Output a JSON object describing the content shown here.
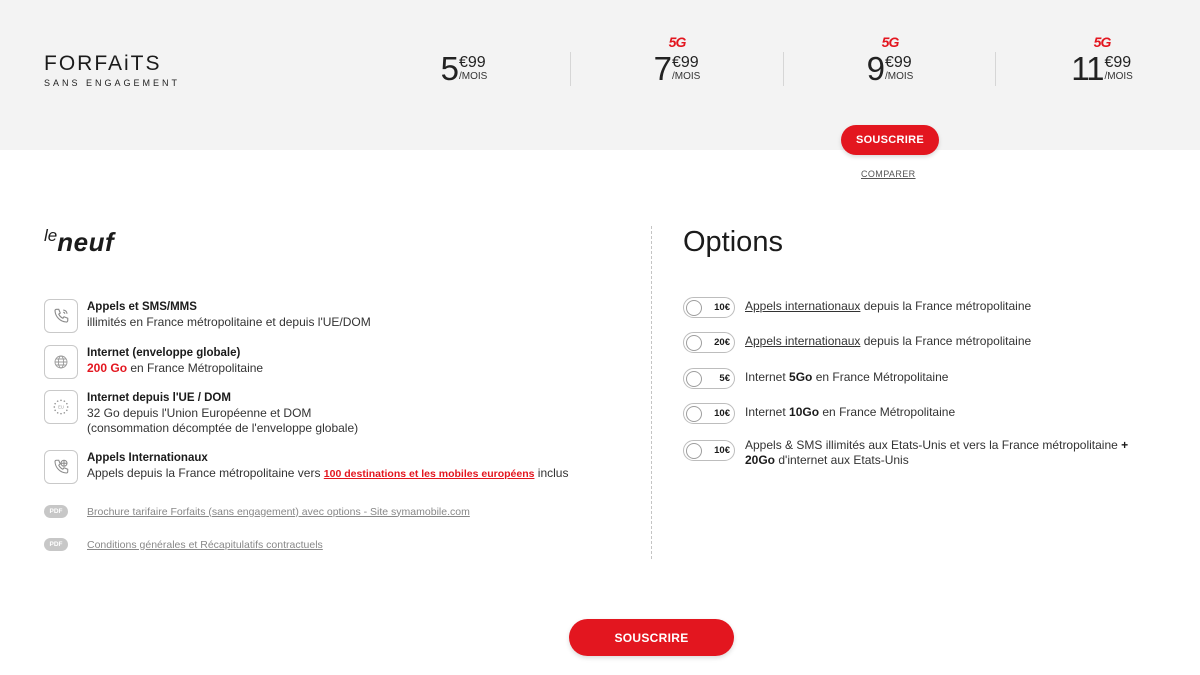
{
  "brand": {
    "title": "FORFAiTS",
    "subtitle": "SANS ENGAGEMENT"
  },
  "plans": [
    {
      "int": "5",
      "cents": "€99",
      "unit": "/MOIS",
      "badge": ""
    },
    {
      "int": "7",
      "cents": "€99",
      "unit": "/MOIS",
      "badge": "5G"
    },
    {
      "int": "9",
      "cents": "€99",
      "unit": "/MOIS",
      "badge": "5G"
    },
    {
      "int": "11",
      "cents": "€99",
      "unit": "/MOIS",
      "badge": "5G"
    }
  ],
  "subscribe_label": "SOUSCRIRE",
  "compare_label": "COMPARER",
  "left": {
    "title_le": "le",
    "title_neuf": "neuf",
    "features": [
      {
        "icon": "phone-icon",
        "title": "Appels et SMS/MMS",
        "line1": "illimités en France métropolitaine et depuis l'UE/DOM"
      },
      {
        "icon": "globe-icon",
        "title": "Internet (enveloppe globale)",
        "highlight": "200 Go",
        "line1": " en France Métropolitaine"
      },
      {
        "icon": "eu-stars-icon",
        "title": "Internet depuis l'UE / DOM",
        "line1": "32 Go depuis l'Union Européenne et DOM",
        "line2": "(consommation décomptée de l'enveloppe globale)"
      },
      {
        "icon": "international-call-icon",
        "title": "Appels Internationaux",
        "line1": "Appels depuis la France métropolitaine vers ",
        "link": "100 destinations et les mobiles européens",
        "line1_end": " inclus"
      }
    ],
    "pdf_badge": "PDF",
    "docs": [
      "Brochure tarifaire Forfaits (sans engagement) avec options - Site symamobile.com",
      "Conditions générales et Récapitulatifs contractuels"
    ]
  },
  "options": {
    "title": "Options",
    "items": [
      {
        "price": "10€",
        "link": "Appels internationaux",
        "text": " depuis la France métropolitaine"
      },
      {
        "price": "20€",
        "link": "Appels internationaux",
        "text": " depuis la France métropolitaine"
      },
      {
        "price": "5€",
        "pre": "Internet ",
        "bold": "5Go",
        "text": " en France Métropolitaine"
      },
      {
        "price": "10€",
        "pre": "Internet ",
        "bold": "10Go",
        "text": " en France Métropolitaine"
      },
      {
        "price": "10€",
        "pre": "Appels & SMS illimités aux Etats-Unis et vers la France métropolitaine ",
        "bold": "+",
        "bold2": "20Go",
        "text": " d'internet aux Etats-Unis"
      }
    ]
  },
  "colors": {
    "accent": "#e3161f",
    "band": "#f3f3f3"
  }
}
